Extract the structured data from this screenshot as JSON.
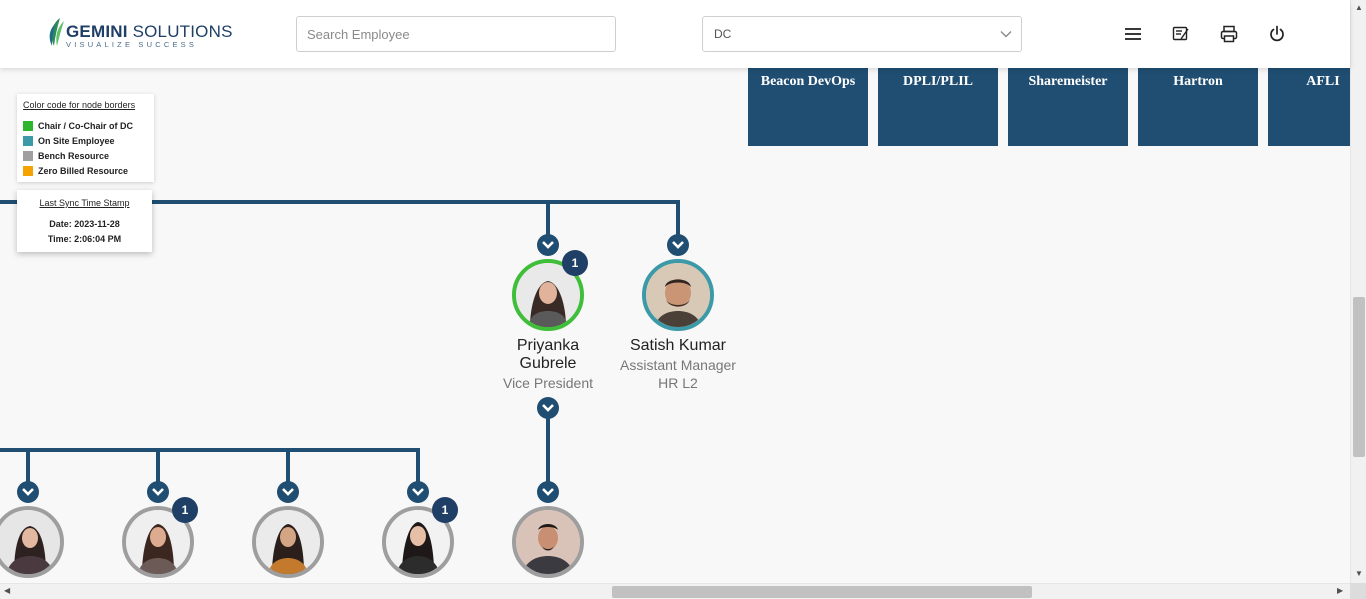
{
  "header": {
    "logo_brand": "GEMINI",
    "logo_suffix": " SOLUTIONS",
    "logo_tagline": "VISUALIZE SUCCESS",
    "search_placeholder": "Search Employee",
    "dc_select_value": "DC",
    "icons": [
      "menu-icon",
      "edit-note-icon",
      "print-icon",
      "power-icon"
    ]
  },
  "dc_boxes": [
    "Beacon DevOps",
    "DPLI/PLIL",
    "Sharemeister",
    "Hartron",
    "AFLI"
  ],
  "legend": {
    "title": "Color code for node borders",
    "items": [
      {
        "label": "Chair / Co-Chair of DC",
        "color": "#2db52d"
      },
      {
        "label": "On Site Employee",
        "color": "#3c99a8"
      },
      {
        "label": "Bench Resource",
        "color": "#a0a0a0"
      },
      {
        "label": "Zero Billed Resource",
        "color": "#f5a300"
      }
    ]
  },
  "sync": {
    "title": "Last Sync Time Stamp",
    "date": "Date: 2023-11-28",
    "time": "Time: 2:06:04 PM"
  },
  "people": [
    {
      "name": "Priyanka Gubrele",
      "title": "Vice President",
      "badge": "1",
      "border": "#3fbe39"
    },
    {
      "name": "Satish Kumar",
      "title": "Assistant Manager",
      "subtitle": "HR L2",
      "border": "#3c99a8"
    }
  ],
  "child_badges": [
    "1",
    "1"
  ],
  "colors": {
    "primary": "#1f4e72",
    "badge": "#1f3f66",
    "connector": "#1f4e72"
  }
}
